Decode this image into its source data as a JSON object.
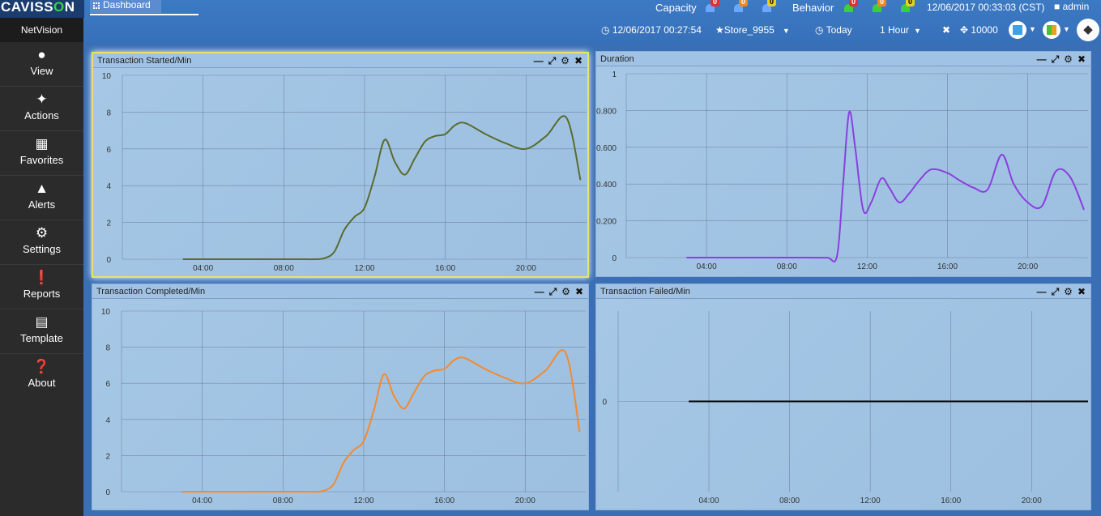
{
  "topbar": {
    "logo_left": "CAVISS",
    "logo_o": "O",
    "logo_right": "N",
    "dashboard_tab": "Dashboard",
    "capacity_label": "Capacity",
    "behavior_label": "Behavior",
    "alert_counts": [
      "0",
      "0",
      "0",
      "0",
      "0",
      "0"
    ],
    "datetime": "12/06/2017 00:33:03 (CST)",
    "user": "admin",
    "start_time": "12/06/2017 00:27:54",
    "store": "Store_9955",
    "range_today": "Today",
    "range_duration": "1 Hour",
    "value_count": "10000"
  },
  "sidebar": {
    "title": "NetVision",
    "items": [
      {
        "label": "View",
        "icon": "user-icon"
      },
      {
        "label": "Actions",
        "icon": "puzzle-icon"
      },
      {
        "label": "Favorites",
        "icon": "grid-icon"
      },
      {
        "label": "Alerts",
        "icon": "bell-icon"
      },
      {
        "label": "Settings",
        "icon": "gear-icon"
      },
      {
        "label": "Reports",
        "icon": "exclamation-icon"
      },
      {
        "label": "Template",
        "icon": "template-icon"
      },
      {
        "label": "About",
        "icon": "question-icon"
      }
    ]
  },
  "panels": [
    {
      "title": "Transaction Started/Min"
    },
    {
      "title": "Duration"
    },
    {
      "title": "Transaction Completed/Min"
    },
    {
      "title": "Transaction Failed/Min"
    }
  ],
  "chart_data": [
    {
      "type": "line",
      "title": "Transaction Started/Min",
      "color": "#5a6b2e",
      "x_ticks": [
        "04:00",
        "08:00",
        "12:00",
        "16:00",
        "20:00"
      ],
      "y_ticks": [
        "0",
        "2",
        "4",
        "6",
        "8",
        "10"
      ],
      "ylim": [
        0,
        10
      ],
      "x_hours": [
        3,
        4,
        5,
        6,
        7,
        8,
        9,
        9.5,
        10,
        10.5,
        11,
        11.5,
        12,
        12.5,
        13,
        13.5,
        14,
        14.5,
        15,
        15.5,
        16,
        16.5,
        17,
        18,
        19,
        20,
        21,
        22,
        22.7
      ],
      "values": [
        0,
        0,
        0,
        0,
        0,
        0,
        0,
        0,
        0.05,
        0.4,
        1.6,
        2.3,
        2.8,
        4.5,
        6.5,
        5.3,
        4.6,
        5.5,
        6.4,
        6.7,
        6.8,
        7.3,
        7.4,
        6.8,
        6.3,
        6.0,
        6.7,
        7.7,
        4.3
      ]
    },
    {
      "type": "line",
      "title": "Duration",
      "color": "#8a3fe0",
      "x_ticks": [
        "04:00",
        "08:00",
        "12:00",
        "16:00",
        "20:00"
      ],
      "y_ticks": [
        "0",
        "0.200",
        "0.400",
        "0.600",
        "0.800",
        "1"
      ],
      "ylim": [
        0,
        1
      ],
      "x_hours": [
        3,
        4,
        5,
        6,
        7,
        8,
        9,
        10,
        10.5,
        10.8,
        11.1,
        11.4,
        11.8,
        12.2,
        12.7,
        13.1,
        13.6,
        14.1,
        14.6,
        15.2,
        16,
        16.6,
        17.3,
        18,
        18.7,
        19.3,
        20,
        20.7,
        21.4,
        22.1,
        22.8
      ],
      "values": [
        0,
        0,
        0,
        0,
        0,
        0,
        0,
        0,
        0.01,
        0.4,
        0.79,
        0.6,
        0.26,
        0.3,
        0.43,
        0.38,
        0.3,
        0.35,
        0.42,
        0.48,
        0.46,
        0.42,
        0.38,
        0.37,
        0.56,
        0.4,
        0.3,
        0.28,
        0.47,
        0.44,
        0.26
      ]
    },
    {
      "type": "line",
      "title": "Transaction Completed/Min",
      "color": "#f28a30",
      "x_ticks": [
        "04:00",
        "08:00",
        "12:00",
        "16:00",
        "20:00"
      ],
      "y_ticks": [
        "0",
        "2",
        "4",
        "6",
        "8",
        "10"
      ],
      "ylim": [
        0,
        10
      ],
      "x_hours": [
        3,
        4,
        5,
        6,
        7,
        8,
        9,
        9.5,
        10,
        10.5,
        11,
        11.5,
        12,
        12.5,
        13,
        13.5,
        14,
        14.5,
        15,
        15.5,
        16,
        16.5,
        17,
        18,
        19,
        20,
        21,
        22,
        22.7
      ],
      "values": [
        0,
        0,
        0,
        0,
        0,
        0,
        0,
        0,
        0.05,
        0.4,
        1.6,
        2.3,
        2.8,
        4.5,
        6.5,
        5.3,
        4.6,
        5.5,
        6.4,
        6.7,
        6.8,
        7.3,
        7.4,
        6.8,
        6.3,
        6.0,
        6.7,
        7.7,
        3.3
      ]
    },
    {
      "type": "line",
      "title": "Transaction Failed/Min",
      "color": "#000000",
      "x_ticks": [
        "04:00",
        "08:00",
        "12:00",
        "16:00",
        "20:00"
      ],
      "y_ticks": [
        "0"
      ],
      "ylim": [
        -1,
        1
      ],
      "x_hours": [
        3,
        22.8
      ],
      "values": [
        0,
        0
      ]
    }
  ]
}
